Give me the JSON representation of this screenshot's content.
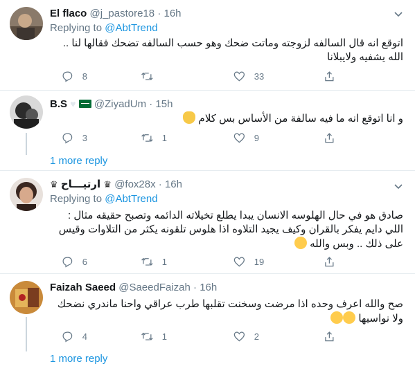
{
  "tweets": [
    {
      "name": "El flaco",
      "handle": "@j_pastore18",
      "dot": "·",
      "time": "16h",
      "replying_label": "Replying to",
      "replying_to": "@AbtTrend",
      "text": "اتوقع انه قال السالفه لزوجته وماتت ضحك وهو حسب السالفه تضحك فقالها لنا .. الله يشفيه ولايبلانا",
      "replies": "8",
      "retweets": "",
      "likes": "33"
    },
    {
      "name": "B.S",
      "handle": "@ZiyadUm",
      "dot": "·",
      "time": "15h",
      "text": "و انا اتوقع انه ما فيه سالفة من الأساس بس كلام",
      "replies": "3",
      "retweets": "1",
      "likes": "9",
      "more_replies": "1 more reply"
    },
    {
      "name": "ارتيـــاح",
      "handle": "@fox28x",
      "dot": "·",
      "time": "16h",
      "replying_label": "Replying to",
      "replying_to": "@AbtTrend",
      "text": "صادق هو في حال الهلوسه الانسان يبدا يطلع تخيلاته الدائمه وتصبح حقيقه مثال : اللي دايم يفكر بالقران وكيف يجيد التلاوه اذا هلوس تلقونه يكثر من التلاوات وقيس على ذلك .. وبس والله",
      "replies": "6",
      "retweets": "1",
      "likes": "19"
    },
    {
      "name": "Faizah Saeed",
      "handle": "@SaeedFaizah",
      "dot": "·",
      "time": "16h",
      "text": "صح والله اعرف وحده اذا مرضت وسخنت تقلبها طرب عراقي  واحنا ماندري نضحك ولا نواسيها",
      "replies": "4",
      "retweets": "1",
      "likes": "2",
      "more_replies": "1 more reply"
    }
  ]
}
